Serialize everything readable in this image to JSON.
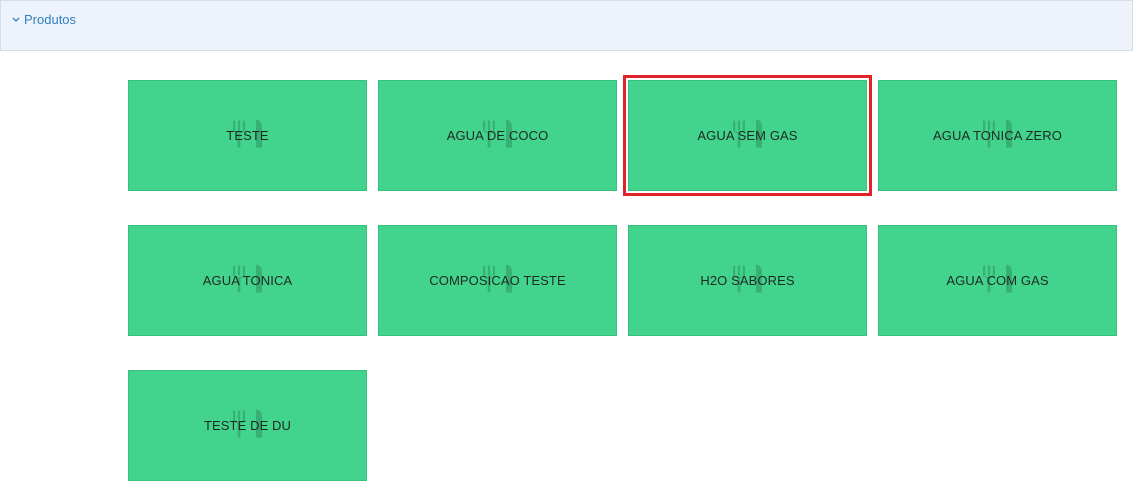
{
  "section": {
    "title": "Produtos",
    "toggle_icon": "chevron-down-icon"
  },
  "products": [
    {
      "label": "TESTE",
      "selected": false
    },
    {
      "label": "AGUA DE COCO",
      "selected": false
    },
    {
      "label": "AGUA SEM GAS",
      "selected": true
    },
    {
      "label": "AGUA TONICA ZERO",
      "selected": false
    },
    {
      "label": "AGUA TONICA",
      "selected": false
    },
    {
      "label": "COMPOSICAO TESTE",
      "selected": false
    },
    {
      "label": "H2O SABORES",
      "selected": false
    },
    {
      "label": "AGUA COM GAS",
      "selected": false
    },
    {
      "label": "TESTE DE DU",
      "selected": false
    }
  ],
  "tile_icon": "fork-knife-icon",
  "colors": {
    "tile": "#42d38c",
    "selected_outline": "#e0232b",
    "header_bg": "#eef3fb",
    "header_text": "#2e7fbf"
  }
}
